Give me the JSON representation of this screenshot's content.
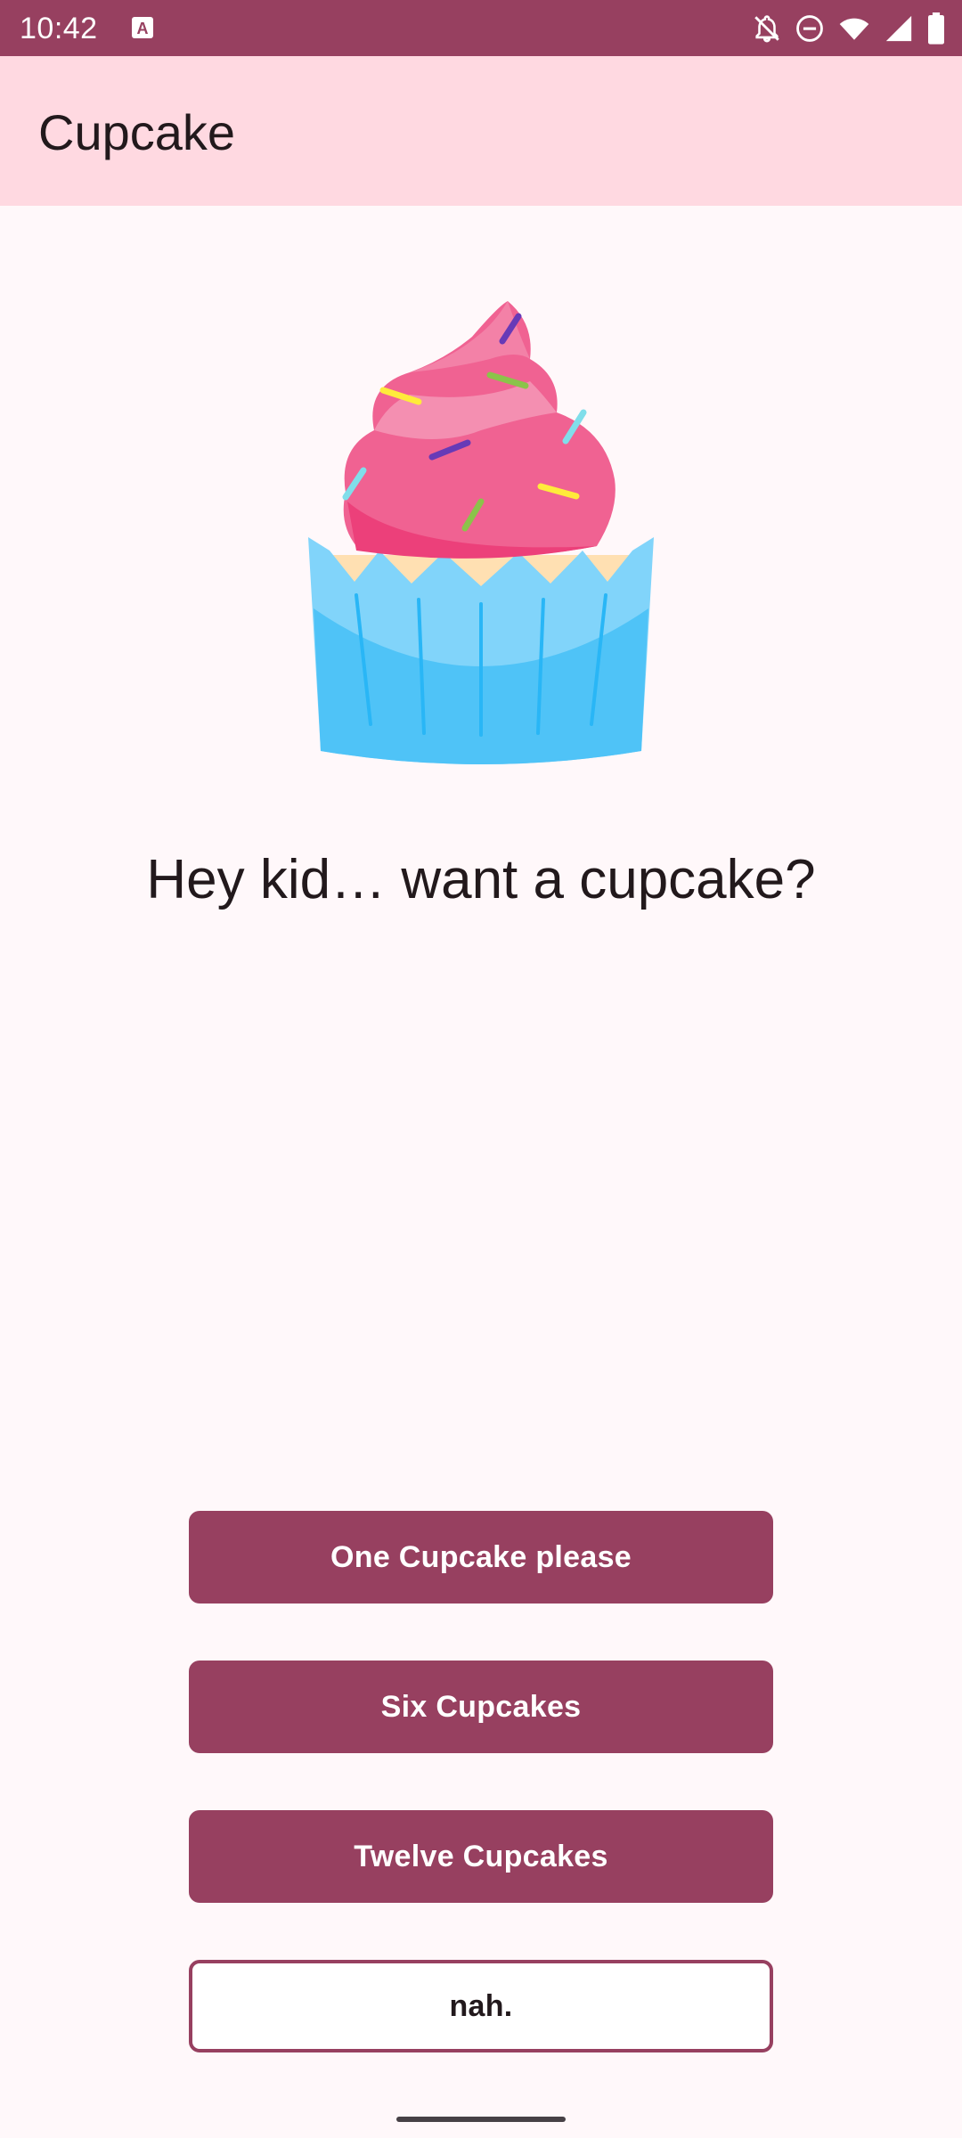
{
  "status_bar": {
    "time": "10:42",
    "notification_icon": "font-a-icon",
    "icons": [
      "notifications-off-icon",
      "do-not-disturb-icon",
      "wifi-icon",
      "signal-icon",
      "battery-icon"
    ]
  },
  "app_bar": {
    "title": "Cupcake"
  },
  "main": {
    "image": "cupcake-illustration",
    "headline": "Hey kid… want a cupcake?"
  },
  "buttons": {
    "one": "One Cupcake please",
    "six": "Six Cupcakes",
    "twelve": "Twelve Cupcakes",
    "nah": "nah."
  },
  "colors": {
    "primary": "#974060",
    "app_bar_bg": "#ffd9e1",
    "background": "#fff8fa",
    "text": "#22191c"
  }
}
